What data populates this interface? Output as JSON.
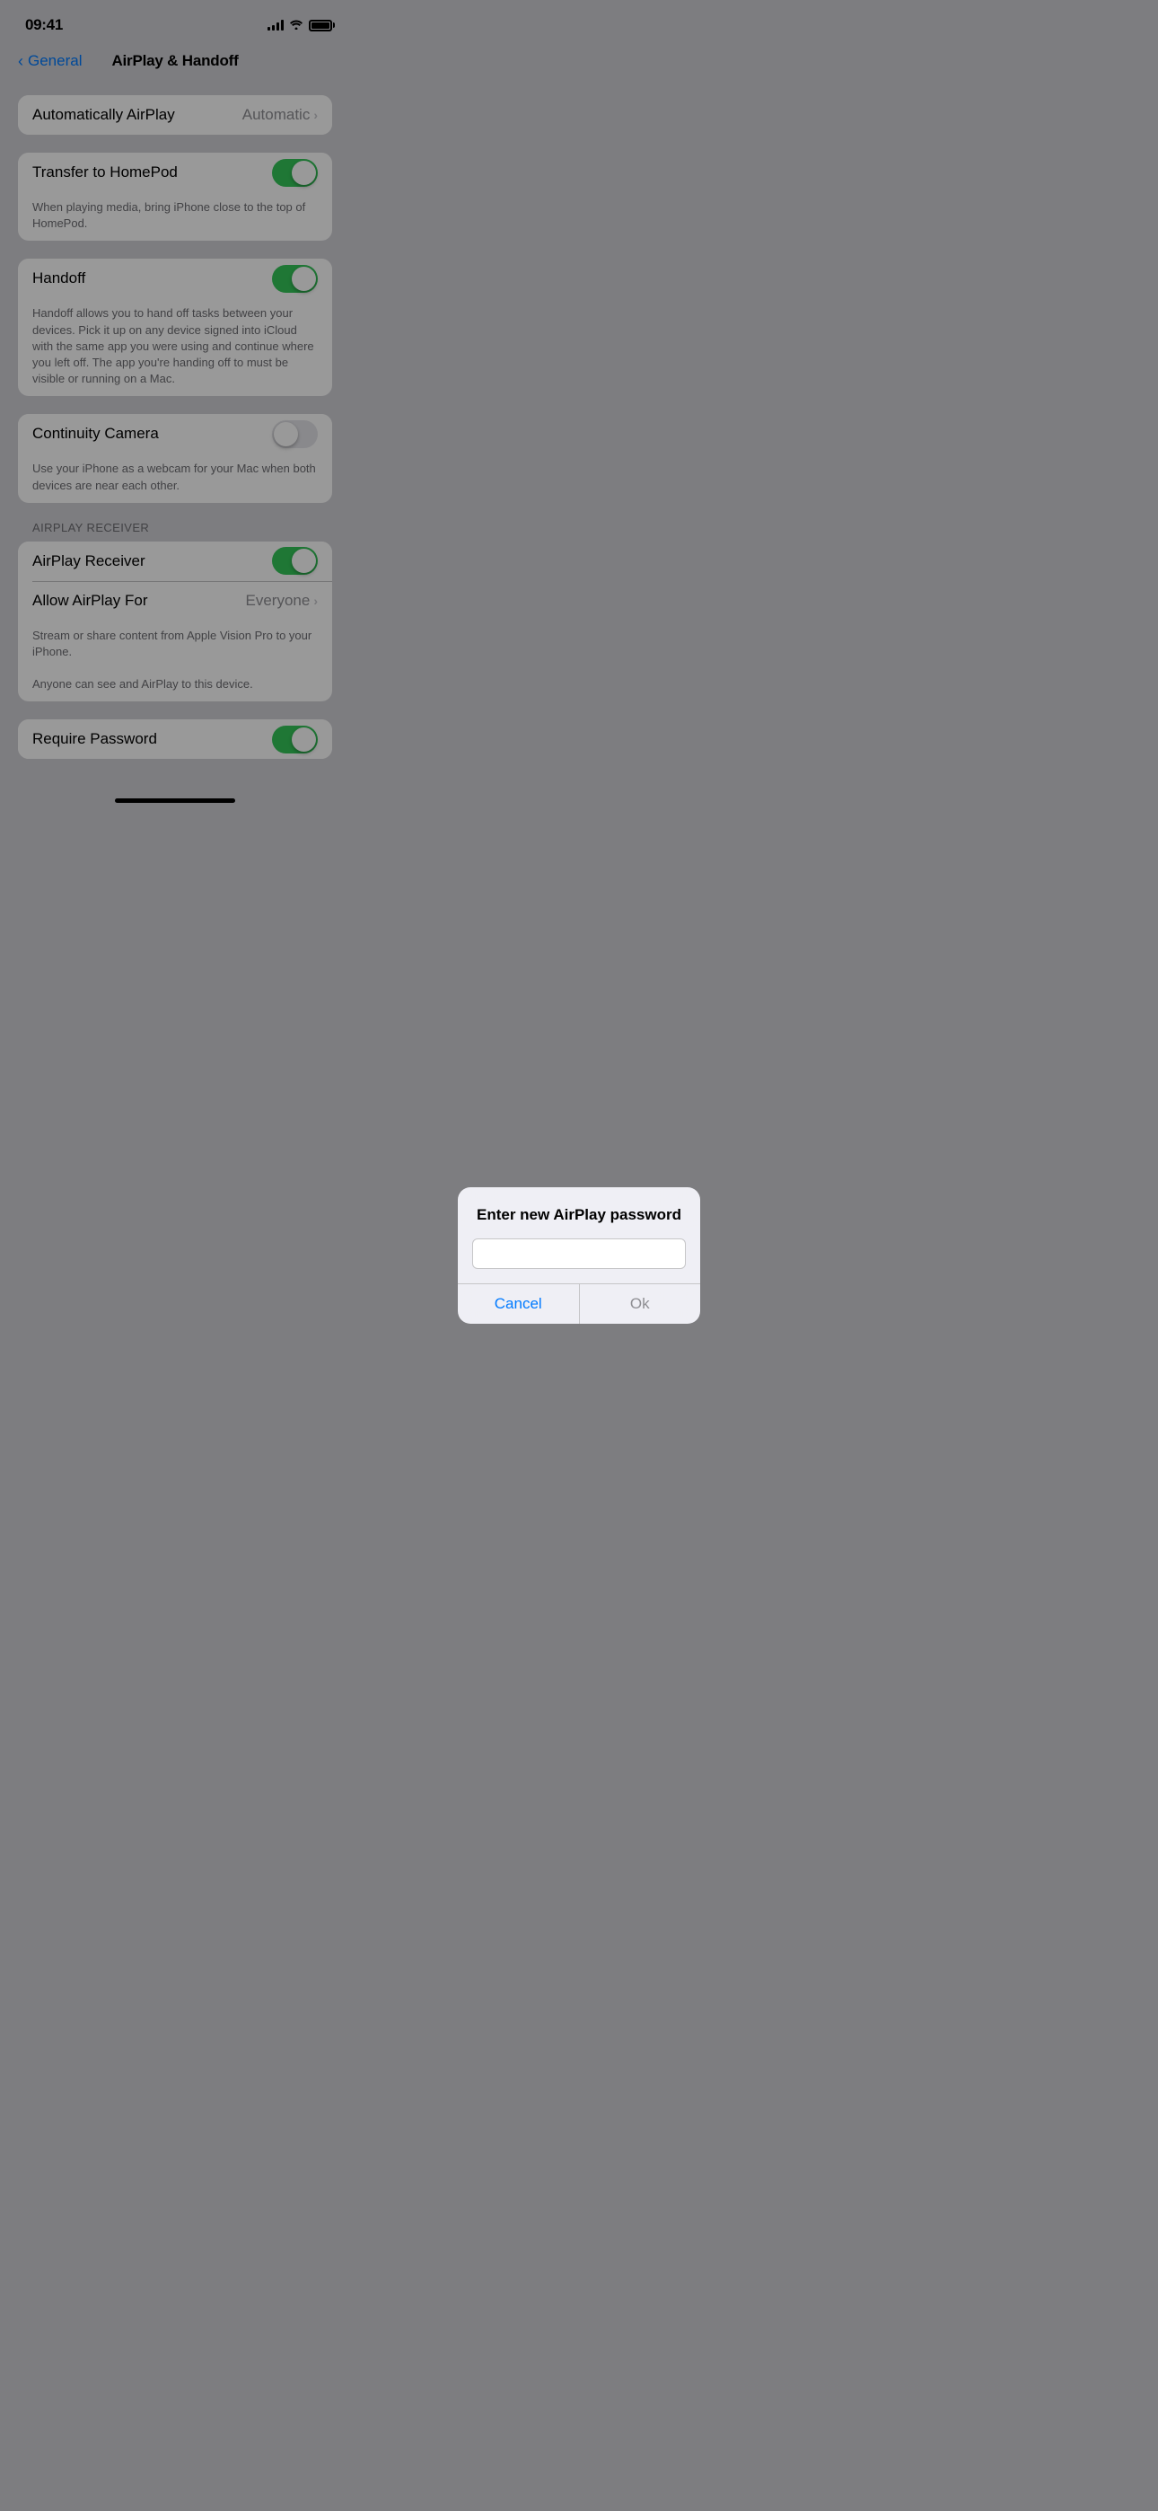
{
  "statusBar": {
    "time": "09:41"
  },
  "nav": {
    "backLabel": "General",
    "title": "AirPlay & Handoff"
  },
  "sections": {
    "autoAirplay": {
      "label": "Automatically AirPlay",
      "value": "Automatic"
    },
    "transferHomePod": {
      "label": "Transfer to HomePod",
      "enabled": true,
      "description": "When playing media, bring iPhone close to the top of HomePod."
    },
    "handoff": {
      "label": "Handoff",
      "enabled": true,
      "description": "Handoff allows you to hand off tasks between your devices. Pick it up on any device signed into iCloud with the same app you were using and continue where you left off. The app you're handing off to must be visible or running on a Mac."
    },
    "continuityCamera": {
      "label": "Continuity Camera",
      "enabled": false,
      "description": "Use your iPhone as a webcam for your Mac when both devices are near each other."
    },
    "airplayReceiver": {
      "sectionLabel": "AIRPLAY RECEIVER",
      "items": [
        {
          "label": "AirPlay Receiver",
          "type": "toggle",
          "enabled": true
        },
        {
          "label": "Allow AirPlay For",
          "type": "value",
          "value": "Everyone"
        }
      ],
      "description1": "Stream or share content from Apple Vision Pro to your iPhone.",
      "description2": "Anyone can see and AirPlay to this device."
    },
    "requirePassword": {
      "label": "Require Password",
      "enabled": true
    }
  },
  "dialog": {
    "title": "Enter new AirPlay password",
    "inputPlaceholder": "",
    "cancelLabel": "Cancel",
    "okLabel": "Ok"
  }
}
